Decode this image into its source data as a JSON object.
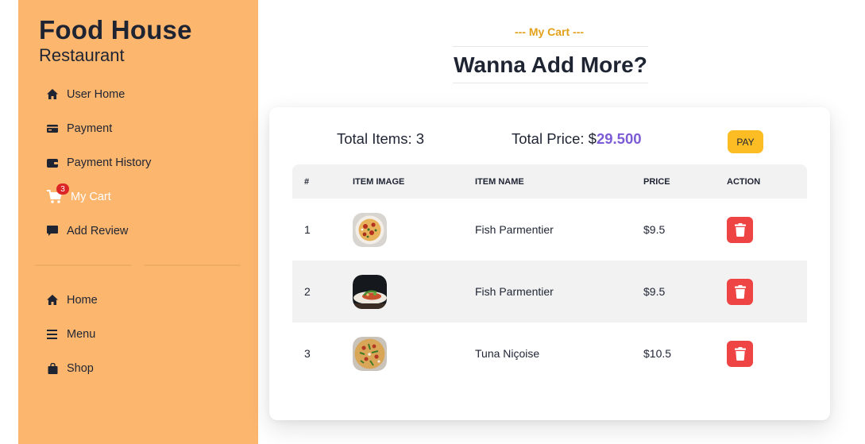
{
  "brand": {
    "title": "Food House",
    "subtitle": "Restaurant"
  },
  "sidebar": {
    "items": [
      {
        "label": "User Home",
        "icon": "home-icon"
      },
      {
        "label": "Payment",
        "icon": "card-icon"
      },
      {
        "label": "Payment History",
        "icon": "wallet-icon"
      },
      {
        "label": "My Cart",
        "icon": "cart-icon",
        "badge": "3",
        "active": true
      },
      {
        "label": "Add Review",
        "icon": "comment-icon"
      }
    ],
    "items2": [
      {
        "label": "Home",
        "icon": "home-icon"
      },
      {
        "label": "Menu",
        "icon": "menu-icon"
      },
      {
        "label": "Shop",
        "icon": "bag-icon"
      }
    ]
  },
  "header": {
    "subheading": "--- My Cart ---",
    "title": "Wanna Add More?"
  },
  "summary": {
    "items_label": "Total Items: 3",
    "price_label": "Total Price: $",
    "price_value": "29.500",
    "pay_label": "PAY"
  },
  "table": {
    "columns": [
      "#",
      "ITEM IMAGE",
      "ITEM NAME",
      "PRICE",
      "ACTION"
    ],
    "rows": [
      {
        "num": "1",
        "name": "Fish Parmentier",
        "price": "$9.5",
        "image": "pizza-image"
      },
      {
        "num": "2",
        "name": "Fish Parmentier",
        "price": "$9.5",
        "image": "salad-plate-image"
      },
      {
        "num": "3",
        "name": "Tuna Niçoise",
        "price": "$10.5",
        "image": "pizza-image"
      }
    ]
  },
  "colors": {
    "sidebar": "#fdb66e",
    "accent": "#e2a11a",
    "price": "#7c5cd6",
    "pay": "#fbbd23",
    "delete": "#ef4444"
  }
}
